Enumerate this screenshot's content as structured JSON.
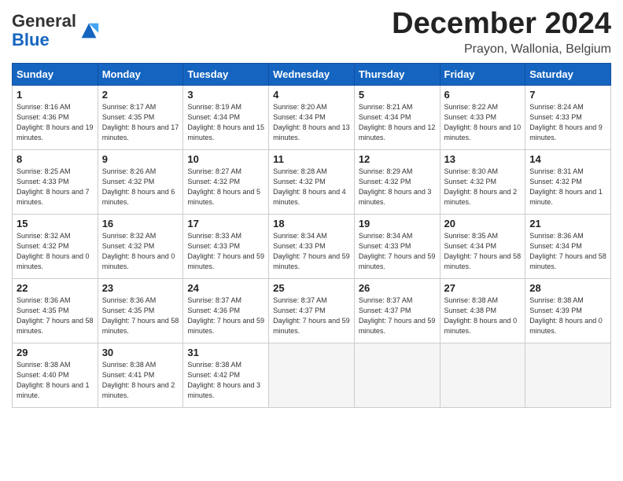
{
  "logo": {
    "general": "General",
    "blue": "Blue"
  },
  "title": "December 2024",
  "location": "Prayon, Wallonia, Belgium",
  "days_of_week": [
    "Sunday",
    "Monday",
    "Tuesday",
    "Wednesday",
    "Thursday",
    "Friday",
    "Saturday"
  ],
  "weeks": [
    [
      {
        "day": "1",
        "sunrise": "8:16 AM",
        "sunset": "4:36 PM",
        "daylight": "8 hours and 19 minutes."
      },
      {
        "day": "2",
        "sunrise": "8:17 AM",
        "sunset": "4:35 PM",
        "daylight": "8 hours and 17 minutes."
      },
      {
        "day": "3",
        "sunrise": "8:19 AM",
        "sunset": "4:34 PM",
        "daylight": "8 hours and 15 minutes."
      },
      {
        "day": "4",
        "sunrise": "8:20 AM",
        "sunset": "4:34 PM",
        "daylight": "8 hours and 13 minutes."
      },
      {
        "day": "5",
        "sunrise": "8:21 AM",
        "sunset": "4:34 PM",
        "daylight": "8 hours and 12 minutes."
      },
      {
        "day": "6",
        "sunrise": "8:22 AM",
        "sunset": "4:33 PM",
        "daylight": "8 hours and 10 minutes."
      },
      {
        "day": "7",
        "sunrise": "8:24 AM",
        "sunset": "4:33 PM",
        "daylight": "8 hours and 9 minutes."
      }
    ],
    [
      {
        "day": "8",
        "sunrise": "8:25 AM",
        "sunset": "4:33 PM",
        "daylight": "8 hours and 7 minutes."
      },
      {
        "day": "9",
        "sunrise": "8:26 AM",
        "sunset": "4:32 PM",
        "daylight": "8 hours and 6 minutes."
      },
      {
        "day": "10",
        "sunrise": "8:27 AM",
        "sunset": "4:32 PM",
        "daylight": "8 hours and 5 minutes."
      },
      {
        "day": "11",
        "sunrise": "8:28 AM",
        "sunset": "4:32 PM",
        "daylight": "8 hours and 4 minutes."
      },
      {
        "day": "12",
        "sunrise": "8:29 AM",
        "sunset": "4:32 PM",
        "daylight": "8 hours and 3 minutes."
      },
      {
        "day": "13",
        "sunrise": "8:30 AM",
        "sunset": "4:32 PM",
        "daylight": "8 hours and 2 minutes."
      },
      {
        "day": "14",
        "sunrise": "8:31 AM",
        "sunset": "4:32 PM",
        "daylight": "8 hours and 1 minute."
      }
    ],
    [
      {
        "day": "15",
        "sunrise": "8:32 AM",
        "sunset": "4:32 PM",
        "daylight": "8 hours and 0 minutes."
      },
      {
        "day": "16",
        "sunrise": "8:32 AM",
        "sunset": "4:32 PM",
        "daylight": "8 hours and 0 minutes."
      },
      {
        "day": "17",
        "sunrise": "8:33 AM",
        "sunset": "4:33 PM",
        "daylight": "7 hours and 59 minutes."
      },
      {
        "day": "18",
        "sunrise": "8:34 AM",
        "sunset": "4:33 PM",
        "daylight": "7 hours and 59 minutes."
      },
      {
        "day": "19",
        "sunrise": "8:34 AM",
        "sunset": "4:33 PM",
        "daylight": "7 hours and 59 minutes."
      },
      {
        "day": "20",
        "sunrise": "8:35 AM",
        "sunset": "4:34 PM",
        "daylight": "7 hours and 58 minutes."
      },
      {
        "day": "21",
        "sunrise": "8:36 AM",
        "sunset": "4:34 PM",
        "daylight": "7 hours and 58 minutes."
      }
    ],
    [
      {
        "day": "22",
        "sunrise": "8:36 AM",
        "sunset": "4:35 PM",
        "daylight": "7 hours and 58 minutes."
      },
      {
        "day": "23",
        "sunrise": "8:36 AM",
        "sunset": "4:35 PM",
        "daylight": "7 hours and 58 minutes."
      },
      {
        "day": "24",
        "sunrise": "8:37 AM",
        "sunset": "4:36 PM",
        "daylight": "7 hours and 59 minutes."
      },
      {
        "day": "25",
        "sunrise": "8:37 AM",
        "sunset": "4:37 PM",
        "daylight": "7 hours and 59 minutes."
      },
      {
        "day": "26",
        "sunrise": "8:37 AM",
        "sunset": "4:37 PM",
        "daylight": "7 hours and 59 minutes."
      },
      {
        "day": "27",
        "sunrise": "8:38 AM",
        "sunset": "4:38 PM",
        "daylight": "8 hours and 0 minutes."
      },
      {
        "day": "28",
        "sunrise": "8:38 AM",
        "sunset": "4:39 PM",
        "daylight": "8 hours and 0 minutes."
      }
    ],
    [
      {
        "day": "29",
        "sunrise": "8:38 AM",
        "sunset": "4:40 PM",
        "daylight": "8 hours and 1 minute."
      },
      {
        "day": "30",
        "sunrise": "8:38 AM",
        "sunset": "4:41 PM",
        "daylight": "8 hours and 2 minutes."
      },
      {
        "day": "31",
        "sunrise": "8:38 AM",
        "sunset": "4:42 PM",
        "daylight": "8 hours and 3 minutes."
      },
      null,
      null,
      null,
      null
    ]
  ]
}
